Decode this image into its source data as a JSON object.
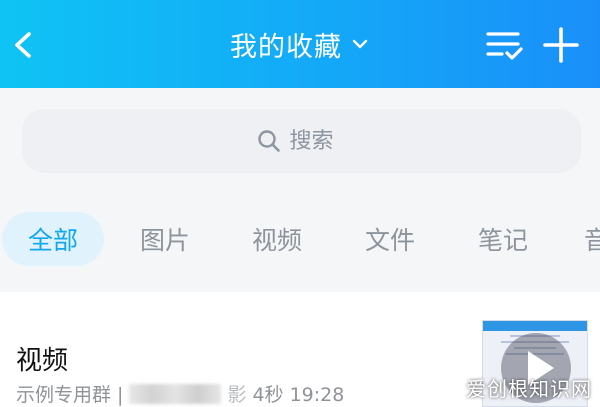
{
  "header": {
    "title": "我的收藏",
    "bg_colors": [
      "#0fc4f4",
      "#1a8ff9"
    ]
  },
  "search": {
    "placeholder": "搜索"
  },
  "tabs": [
    {
      "label": "全部",
      "active": true
    },
    {
      "label": "图片",
      "active": false
    },
    {
      "label": "视频",
      "active": false
    },
    {
      "label": "文件",
      "active": false
    },
    {
      "label": "笔记",
      "active": false
    },
    {
      "label": "音",
      "active": false
    }
  ],
  "item": {
    "title": "视频",
    "meta_prefix": "示例专用群 |",
    "meta_partial": "影",
    "meta_time": "4秒 19:28"
  },
  "watermark": "爱创根知识网",
  "colors": {
    "accent": "#11a7f0",
    "tab_active_bg": "#e0f3fd"
  }
}
